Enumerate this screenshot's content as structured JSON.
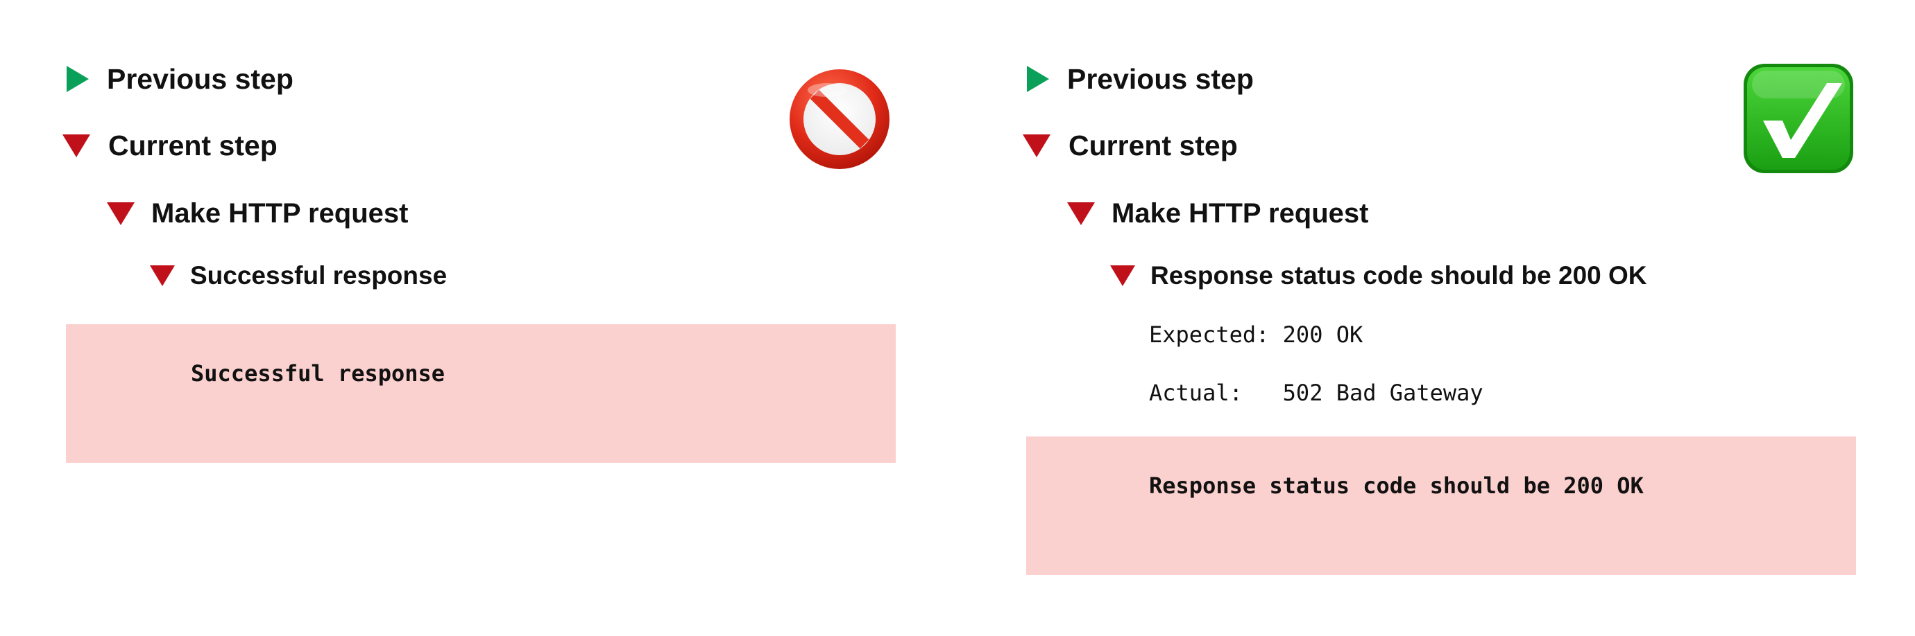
{
  "left": {
    "status_icon": "no-entry-icon",
    "status_color": "#d9261c",
    "previous_step": "Previous step",
    "current_step": "Current step",
    "make_request": "Make HTTP request",
    "assertion": "Successful response",
    "error_message": "Successful response"
  },
  "right": {
    "status_icon": "check-mark-icon",
    "status_color": "#22b520",
    "previous_step": "Previous step",
    "current_step": "Current step",
    "make_request": "Make HTTP request",
    "assertion": "Response status code should be 200 OK",
    "expected_label": "Expected: ",
    "expected_value": "200 OK",
    "actual_label": "Actual:   ",
    "actual_value": "502 Bad Gateway",
    "error_message": "Response status code should be 200 OK"
  },
  "colors": {
    "expand_arrow": "#0aa05a",
    "collapse_arrow": "#c0111b",
    "error_background": "#fbd1cf"
  }
}
